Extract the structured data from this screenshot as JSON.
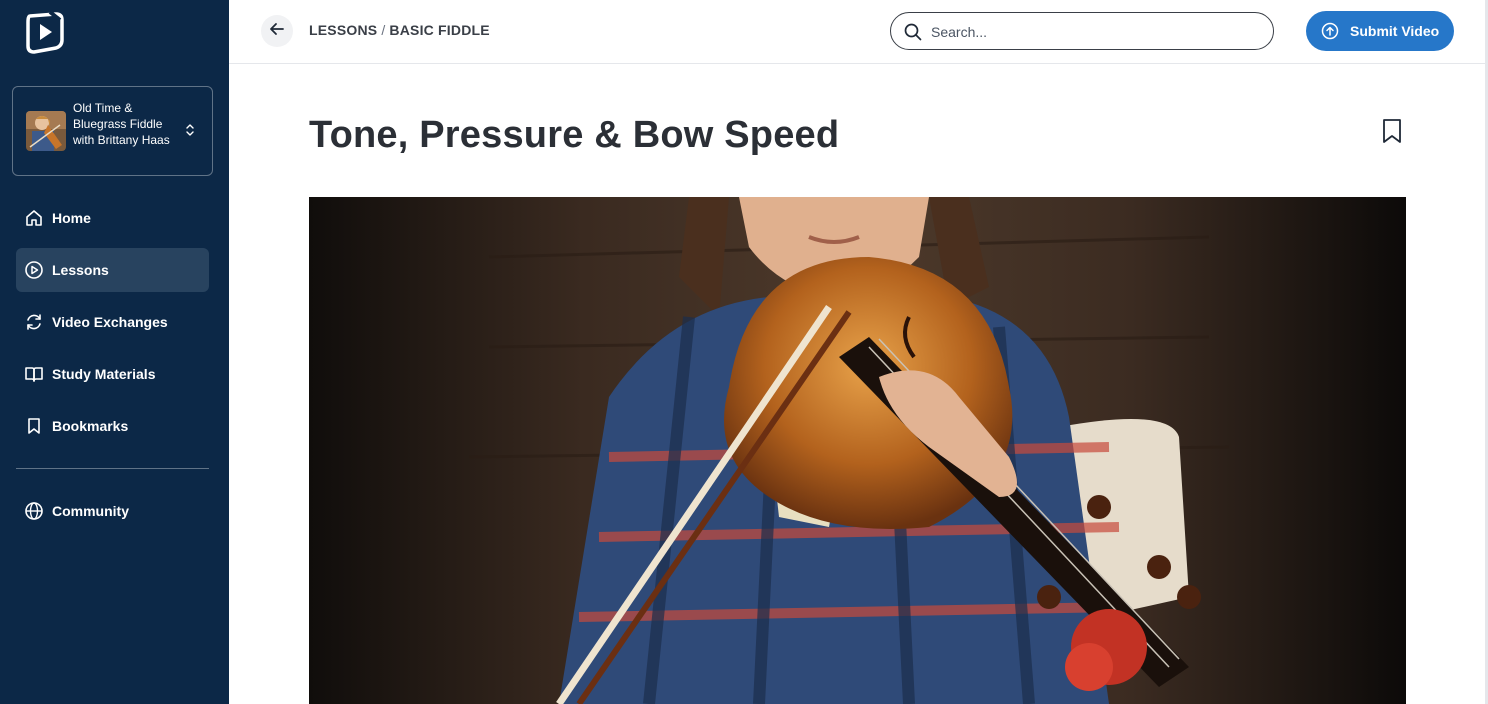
{
  "app": {
    "logo": "play-logo-icon"
  },
  "course": {
    "title": "Old Time & Bluegrass Fiddle with Brittany Haas",
    "thumbnail": "fiddle-player-thumbnail",
    "chevron": "chevron-up-down-icon"
  },
  "sidebar": {
    "items": [
      {
        "label": "Home",
        "icon": "home-icon",
        "active": false
      },
      {
        "label": "Lessons",
        "icon": "play-circle-icon",
        "active": true
      },
      {
        "label": "Video Exchanges",
        "icon": "refresh-icon",
        "active": false
      },
      {
        "label": "Study Materials",
        "icon": "book-icon",
        "active": false
      },
      {
        "label": "Bookmarks",
        "icon": "bookmark-icon",
        "active": false
      }
    ],
    "community": {
      "label": "Community",
      "icon": "globe-icon"
    }
  },
  "header": {
    "breadcrumb": {
      "section": "LESSONS",
      "separator": "/",
      "current": "BASIC FIDDLE"
    },
    "search": {
      "placeholder": "Search...",
      "value": ""
    },
    "submit_label": "Submit Video"
  },
  "lesson": {
    "title": "Tone, Pressure & Bow Speed",
    "video": "fiddle-lesson-video"
  },
  "colors": {
    "sidebar_bg": "#0c2847",
    "sidebar_active": "#28435f",
    "accent": "#2677c9",
    "title_text": "#2b2f36"
  }
}
